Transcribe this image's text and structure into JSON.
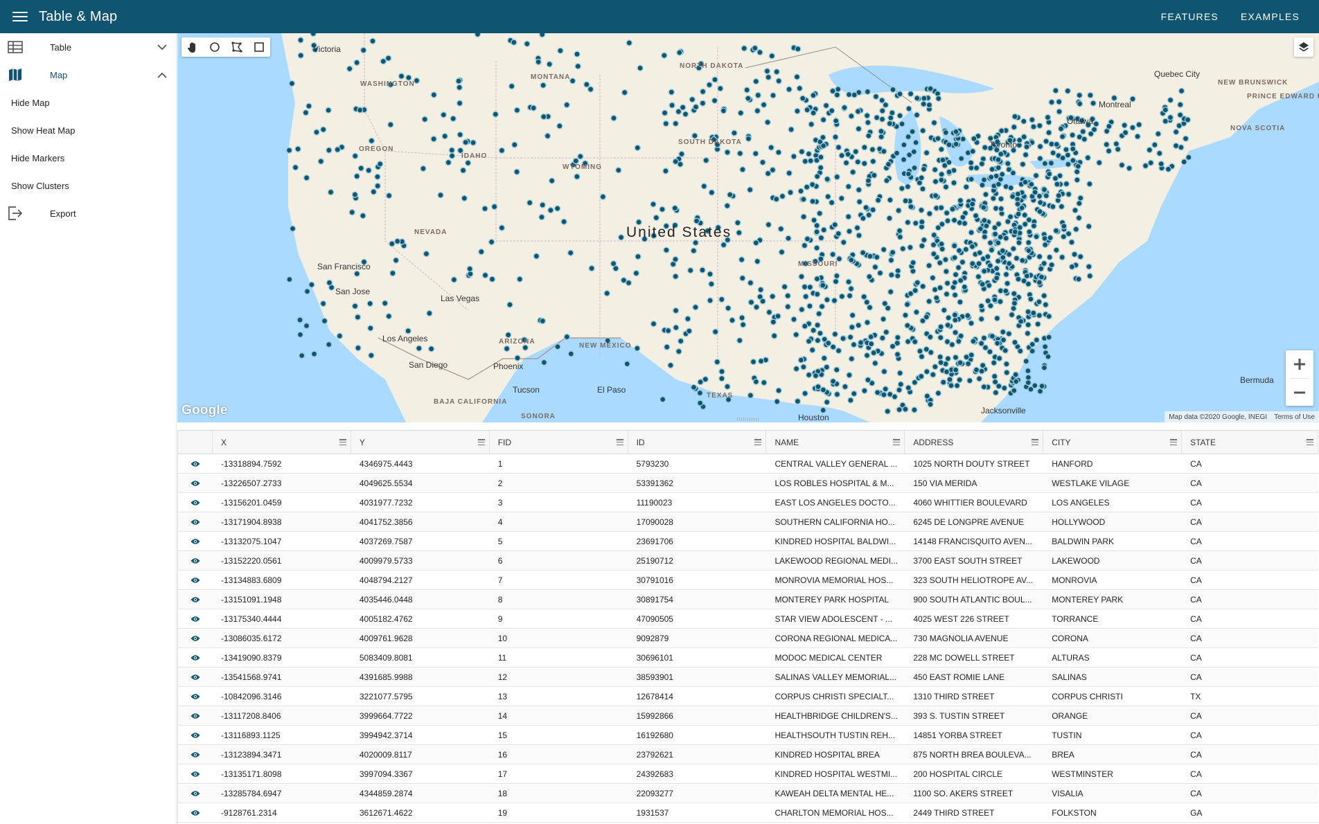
{
  "app": {
    "title": "Table & Map",
    "nav": [
      "FEATURES",
      "EXAMPLES"
    ]
  },
  "sidebar": {
    "sections": [
      {
        "label": "Table",
        "icon": "table-icon",
        "expanded": false
      },
      {
        "label": "Map",
        "icon": "map-icon",
        "expanded": true
      }
    ],
    "map_actions": [
      "Hide Map",
      "Show Heat Map",
      "Hide Markers",
      "Show Clusters"
    ],
    "export_label": "Export"
  },
  "map": {
    "tools": [
      "pan-hand-icon",
      "circle-select-icon",
      "polygon-select-icon",
      "rectangle-select-icon"
    ],
    "layers_icon": "layers-icon",
    "zoom_in": "+",
    "zoom_out": "−",
    "logo": "Google",
    "attribution": "Map data ©2020 Google, INEGI",
    "terms": "Terms of Use",
    "labels": {
      "washington": "WASHINGTON",
      "montana": "MONTANA",
      "north_dakota": "NORTH DAKOTA",
      "oregon": "OREGON",
      "idaho": "IDAHO",
      "south_dakota": "SOUTH DAKOTA",
      "wyoming": "WYOMING",
      "nevada": "NEVADA",
      "united_states": "United States",
      "missouri": "MISSOURI",
      "arizona": "ARIZONA",
      "new_mexico": "NEW MEXICO",
      "texas": "TEXAS",
      "baja_california": "BAJA CALIFORNIA",
      "sonora": "SONORA",
      "new_brunswick": "NEW BRUNSWICK",
      "prince_edward_island": "PRINCE EDWARD ISLAND",
      "nova_scotia": "NOVA SCOTIA",
      "quebec_city": "Quebec City",
      "montreal": "Montreal",
      "ottawa": "Ottawa",
      "toronto": "Toronto",
      "victoria": "Victoria",
      "san_francisco": "San Francisco",
      "san_jose": "San Jose",
      "las_vegas": "Las Vegas",
      "los_angeles": "Los Angeles",
      "san_diego": "San Diego",
      "phoenix": "Phoenix",
      "tucson": "Tucson",
      "el_paso": "El Paso",
      "houston": "Houston",
      "jacksonville": "Jacksonville",
      "bermuda": "Bermuda"
    },
    "marker_color": "#0f5470"
  },
  "table": {
    "columns": [
      "X",
      "Y",
      "FID",
      "ID",
      "NAME",
      "ADDRESS",
      "CITY",
      "STATE"
    ],
    "row_icon": "eye-icon",
    "rows": [
      [
        "-13318894.7592",
        "4346975.4443",
        "1",
        "5793230",
        "CENTRAL VALLEY GENERAL ...",
        "1025 NORTH DOUTY STREET",
        "HANFORD",
        "CA"
      ],
      [
        "-13226507.2733",
        "4049625.5534",
        "2",
        "53391362",
        "LOS ROBLES HOSPITAL & M...",
        "150 VIA MERIDA",
        "WESTLAKE VILAGE",
        "CA"
      ],
      [
        "-13156201.0459",
        "4031977.7232",
        "3",
        "11190023",
        "EAST LOS ANGELES DOCTO...",
        "4060 WHITTIER BOULEVARD",
        "LOS ANGELES",
        "CA"
      ],
      [
        "-13171904.8938",
        "4041752.3856",
        "4",
        "17090028",
        "SOUTHERN CALIFORNIA HO...",
        "6245 DE LONGPRE AVENUE",
        "HOLLYWOOD",
        "CA"
      ],
      [
        "-13132075.1047",
        "4037269.7587",
        "5",
        "23691706",
        "KINDRED HOSPITAL BALDWI...",
        "14148 FRANCISQUITO AVEN...",
        "BALDWIN PARK",
        "CA"
      ],
      [
        "-13152220.0561",
        "4009979.5733",
        "6",
        "25190712",
        "LAKEWOOD REGIONAL MEDI...",
        "3700 EAST SOUTH STREET",
        "LAKEWOOD",
        "CA"
      ],
      [
        "-13134883.6809",
        "4048794.2127",
        "7",
        "30791016",
        "MONROVIA MEMORIAL HOS...",
        "323 SOUTH HELIOTROPE AV...",
        "MONROVIA",
        "CA"
      ],
      [
        "-13151091.1948",
        "4035446.0448",
        "8",
        "30891754",
        "MONTEREY PARK HOSPITAL",
        "900 SOUTH ATLANTIC BOUL...",
        "MONTEREY PARK",
        "CA"
      ],
      [
        "-13175340.4444",
        "4005182.4762",
        "9",
        "47090505",
        "STAR VIEW ADOLESCENT - ...",
        "4025 WEST 226 STREET",
        "TORRANCE",
        "CA"
      ],
      [
        "-13086035.6172",
        "4009761.9628",
        "10",
        "9092879",
        "CORONA REGIONAL MEDICA...",
        "730 MAGNOLIA AVENUE",
        "CORONA",
        "CA"
      ],
      [
        "-13419090.8379",
        "5083409.8081",
        "11",
        "30696101",
        "MODOC MEDICAL CENTER",
        "228 MC DOWELL STREET",
        "ALTURAS",
        "CA"
      ],
      [
        "-13541568.9741",
        "4391685.9988",
        "12",
        "38593901",
        "SALINAS VALLEY MEMORIAL...",
        "450 EAST ROMIE LANE",
        "SALINAS",
        "CA"
      ],
      [
        "-10842096.3146",
        "3221077.5795",
        "13",
        "12678414",
        "CORPUS CHRISTI SPECIALT...",
        "1310 THIRD STREET",
        "CORPUS CHRISTI",
        "TX"
      ],
      [
        "-13117208.8406",
        "3999664.7722",
        "14",
        "15992866",
        "HEALTHBRIDGE CHILDREN'S...",
        "393 S. TUSTIN STREET",
        "ORANGE",
        "CA"
      ],
      [
        "-13116893.1125",
        "3994942.3714",
        "15",
        "16192680",
        "HEALTHSOUTH TUSTIN REH...",
        "14851 YORBA STREET",
        "TUSTIN",
        "CA"
      ],
      [
        "-13123894.3471",
        "4020009.8117",
        "16",
        "23792621",
        "KINDRED HOSPITAL BREA",
        "875 NORTH BREA BOULEVA...",
        "BREA",
        "CA"
      ],
      [
        "-13135171.8098",
        "3997094.3367",
        "17",
        "24392683",
        "KINDRED HOSPITAL WESTMI...",
        "200 HOSPITAL CIRCLE",
        "WESTMINSTER",
        "CA"
      ],
      [
        "-13285784.6947",
        "4344859.2874",
        "18",
        "22093277",
        "KAWEAH DELTA MENTAL HE...",
        "1100 SO. AKERS STREET",
        "VISALIA",
        "CA"
      ],
      [
        "-9128761.2314",
        "3612671.4622",
        "19",
        "1931537",
        "CHARLTON MEMORIAL HOS...",
        "2449 THIRD STREET",
        "FOLKSTON",
        "GA"
      ]
    ]
  }
}
